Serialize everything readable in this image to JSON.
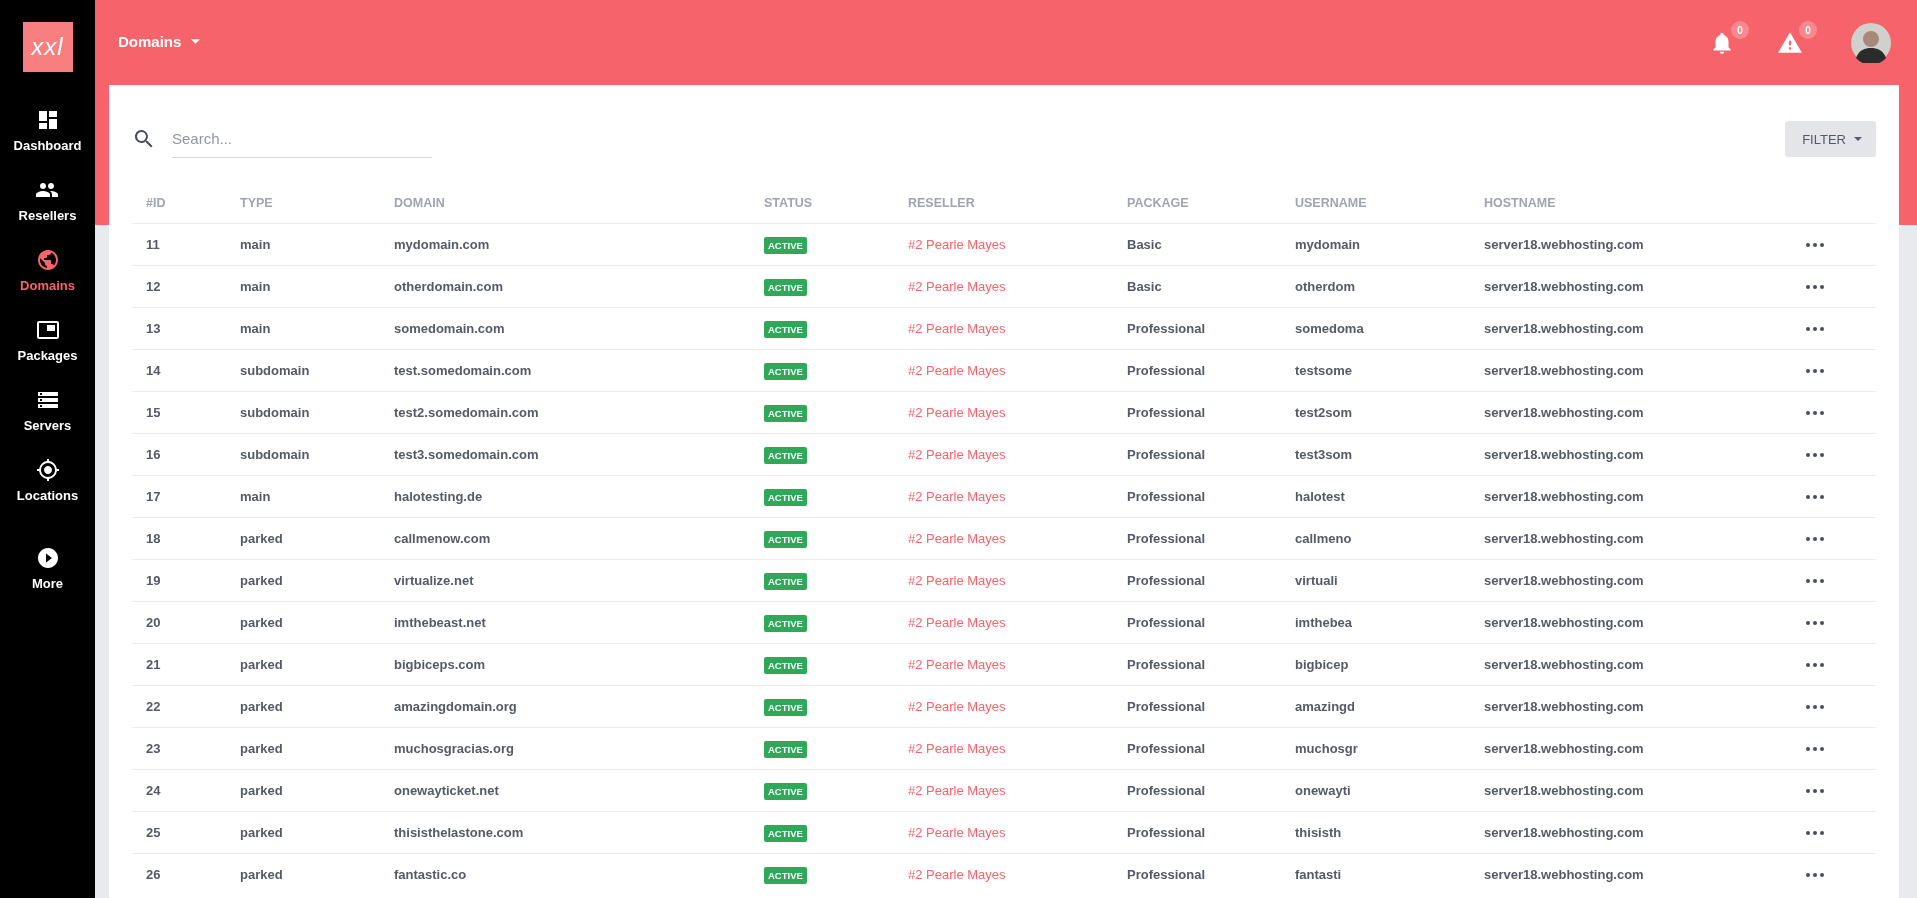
{
  "logo": "xxl",
  "sidebar": {
    "items": [
      {
        "label": "Dashboard",
        "selected": false
      },
      {
        "label": "Resellers",
        "selected": false
      },
      {
        "label": "Domains",
        "selected": true
      },
      {
        "label": "Packages",
        "selected": false
      },
      {
        "label": "Servers",
        "selected": false
      },
      {
        "label": "Locations",
        "selected": false
      },
      {
        "label": "More",
        "selected": false
      }
    ]
  },
  "topbar": {
    "title": "Domains",
    "notifications": "0",
    "alerts": "0"
  },
  "search": {
    "placeholder": "Search..."
  },
  "filter_button": "FILTER",
  "table": {
    "columns": [
      "#ID",
      "TYPE",
      "DOMAIN",
      "STATUS",
      "RESELLER",
      "PACKAGE",
      "USERNAME",
      "HOSTNAME"
    ],
    "rows": [
      {
        "id": "11",
        "type": "main",
        "domain": "mydomain.com",
        "status": "ACTIVE",
        "reseller": "#2 Pearle Mayes",
        "package": "Basic",
        "username": "mydomain",
        "hostname": "server18.webhosting.com"
      },
      {
        "id": "12",
        "type": "main",
        "domain": "otherdomain.com",
        "status": "ACTIVE",
        "reseller": "#2 Pearle Mayes",
        "package": "Basic",
        "username": "otherdom",
        "hostname": "server18.webhosting.com"
      },
      {
        "id": "13",
        "type": "main",
        "domain": "somedomain.com",
        "status": "ACTIVE",
        "reseller": "#2 Pearle Mayes",
        "package": "Professional",
        "username": "somedoma",
        "hostname": "server18.webhosting.com"
      },
      {
        "id": "14",
        "type": "subdomain",
        "domain": "test.somedomain.com",
        "status": "ACTIVE",
        "reseller": "#2 Pearle Mayes",
        "package": "Professional",
        "username": "testsome",
        "hostname": "server18.webhosting.com"
      },
      {
        "id": "15",
        "type": "subdomain",
        "domain": "test2.somedomain.com",
        "status": "ACTIVE",
        "reseller": "#2 Pearle Mayes",
        "package": "Professional",
        "username": "test2som",
        "hostname": "server18.webhosting.com"
      },
      {
        "id": "16",
        "type": "subdomain",
        "domain": "test3.somedomain.com",
        "status": "ACTIVE",
        "reseller": "#2 Pearle Mayes",
        "package": "Professional",
        "username": "test3som",
        "hostname": "server18.webhosting.com"
      },
      {
        "id": "17",
        "type": "main",
        "domain": "halotesting.de",
        "status": "ACTIVE",
        "reseller": "#2 Pearle Mayes",
        "package": "Professional",
        "username": "halotest",
        "hostname": "server18.webhosting.com"
      },
      {
        "id": "18",
        "type": "parked",
        "domain": "callmenow.com",
        "status": "ACTIVE",
        "reseller": "#2 Pearle Mayes",
        "package": "Professional",
        "username": "callmeno",
        "hostname": "server18.webhosting.com"
      },
      {
        "id": "19",
        "type": "parked",
        "domain": "virtualize.net",
        "status": "ACTIVE",
        "reseller": "#2 Pearle Mayes",
        "package": "Professional",
        "username": "virtuali",
        "hostname": "server18.webhosting.com"
      },
      {
        "id": "20",
        "type": "parked",
        "domain": "imthebeast.net",
        "status": "ACTIVE",
        "reseller": "#2 Pearle Mayes",
        "package": "Professional",
        "username": "imthebea",
        "hostname": "server18.webhosting.com"
      },
      {
        "id": "21",
        "type": "parked",
        "domain": "bigbiceps.com",
        "status": "ACTIVE",
        "reseller": "#2 Pearle Mayes",
        "package": "Professional",
        "username": "bigbicep",
        "hostname": "server18.webhosting.com"
      },
      {
        "id": "22",
        "type": "parked",
        "domain": "amazingdomain.org",
        "status": "ACTIVE",
        "reseller": "#2 Pearle Mayes",
        "package": "Professional",
        "username": "amazingd",
        "hostname": "server18.webhosting.com"
      },
      {
        "id": "23",
        "type": "parked",
        "domain": "muchosgracias.org",
        "status": "ACTIVE",
        "reseller": "#2 Pearle Mayes",
        "package": "Professional",
        "username": "muchosgr",
        "hostname": "server18.webhosting.com"
      },
      {
        "id": "24",
        "type": "parked",
        "domain": "onewayticket.net",
        "status": "ACTIVE",
        "reseller": "#2 Pearle Mayes",
        "package": "Professional",
        "username": "onewayti",
        "hostname": "server18.webhosting.com"
      },
      {
        "id": "25",
        "type": "parked",
        "domain": "thisisthelastone.com",
        "status": "ACTIVE",
        "reseller": "#2 Pearle Mayes",
        "package": "Professional",
        "username": "thisisth",
        "hostname": "server18.webhosting.com"
      },
      {
        "id": "26",
        "type": "parked",
        "domain": "fantastic.co",
        "status": "ACTIVE",
        "reseller": "#2 Pearle Mayes",
        "package": "Professional",
        "username": "fantasti",
        "hostname": "server18.webhosting.com"
      }
    ]
  }
}
